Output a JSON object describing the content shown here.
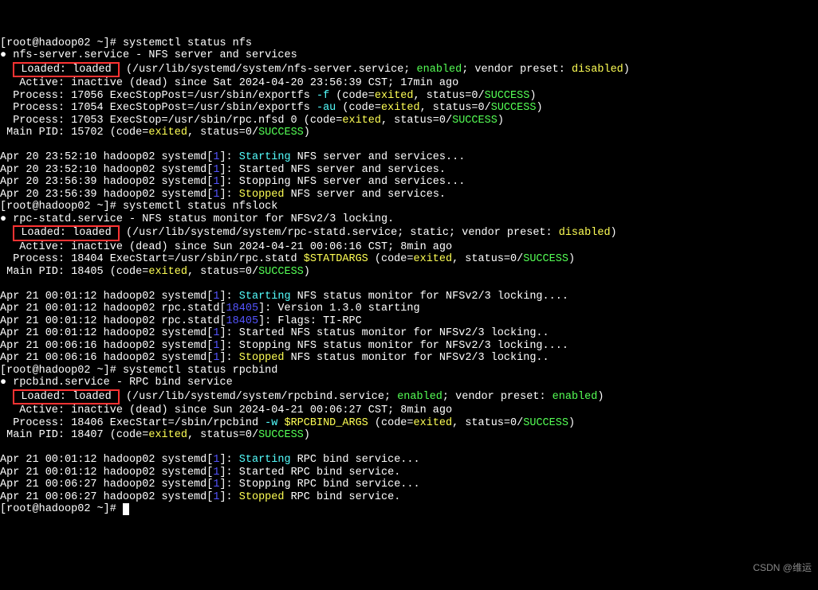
{
  "prompt1": "[root@hadoop02 ~]# ",
  "cmd1": "systemctl status nfs",
  "nfs": {
    "bullet": "●",
    "name": "nfs-server.service",
    "desc": "NFS server and services",
    "loaded_lbl": "Loaded: loaded",
    "loaded_rest": " (/usr/lib/systemd/system/nfs-server.service; ",
    "enabled": "enabled",
    "vendor_preset": "; vendor preset: ",
    "preset_state": "disabled",
    "close": ")",
    "active": "   Active: inactive (dead) since Sat 2024-04-20 23:56:39 CST; 17min ago",
    "proc1_a": "  Process: 17056 ExecStopPost=/usr/sbin/exportfs ",
    "proc1_flag": "-f",
    "proc1_b": " (code=",
    "exited": "exited",
    "status0": ", status=0/",
    "success": "SUCCESS",
    "proc2_a": "  Process: 17054 ExecStopPost=/usr/sbin/exportfs ",
    "proc2_flag": "-au",
    "proc2_b": " (code=",
    "proc3_a": "  Process: 17053 ExecStop=/usr/sbin/rpc.nfsd 0 (code=",
    "mainpid_a": " Main PID: 15702 (code=",
    "log1_a": "Apr 20 23:52:10 hadoop02 systemd[",
    "one": "1",
    "log1_b": "]: ",
    "starting": "Starting",
    "log1_c": " NFS server and services...",
    "log2_a": "Apr 20 23:52:10 hadoop02 systemd[",
    "log2_b": "]: Started NFS server and services.",
    "log3_a": "Apr 20 23:56:39 hadoop02 systemd[",
    "log3_b": "]: Stopping NFS server and services...",
    "log4_a": "Apr 20 23:56:39 hadoop02 systemd[",
    "log4_b": "]: ",
    "stopped": "Stopped",
    "log4_c": " NFS server and services."
  },
  "cmd2": "systemctl status nfslock",
  "statd": {
    "name": "rpc-statd.service",
    "desc": "NFS status monitor for NFSv2/3 locking.",
    "loaded_lbl": "Loaded: loaded",
    "loaded_rest": " (/usr/lib/systemd/system/rpc-statd.service; static; vendor preset: ",
    "preset_state": "disabled",
    "active": "   Active: inactive (dead) since Sun 2024-04-21 00:06:16 CST; 8min ago",
    "proc_a": "  Process: 18404 ExecStart=/usr/sbin/rpc.statd ",
    "statdargs": "$STATDARGS",
    "proc_b": " (code=",
    "mainpid_a": " Main PID: 18405 (code=",
    "log1_a": "Apr 21 00:01:12 hadoop02 systemd[",
    "log1_b": "]: ",
    "log1_c": " NFS status monitor for NFSv2/3 locking....",
    "log2_a": "Apr 21 00:01:12 hadoop02 rpc.statd[",
    "pid18405": "18405",
    "log2_b": "]: Version 1.3.0 starting",
    "log3_a": "Apr 21 00:01:12 hadoop02 rpc.statd[",
    "log3_b": "]: Flags: TI-RPC",
    "log4_a": "Apr 21 00:01:12 hadoop02 systemd[",
    "log4_b": "]: Started NFS status monitor for NFSv2/3 locking..",
    "log5_a": "Apr 21 00:06:16 hadoop02 systemd[",
    "log5_b": "]: Stopping NFS status monitor for NFSv2/3 locking....",
    "log6_a": "Apr 21 00:06:16 hadoop02 systemd[",
    "log6_b": "]: ",
    "log6_c": " NFS status monitor for NFSv2/3 locking.."
  },
  "cmd3": "systemctl status rpcbind",
  "rpc": {
    "name": "rpcbind.service",
    "desc": "RPC bind service",
    "loaded_lbl": "Loaded: loaded",
    "loaded_rest": " (/usr/lib/systemd/system/rpcbind.service; ",
    "enabled": "enabled",
    "vendor_preset": "; vendor preset: ",
    "preset_state": "enabled",
    "active": "   Active: inactive (dead) since Sun 2024-04-21 00:06:27 CST; 8min ago",
    "proc_a": "  Process: 18406 ExecStart=/sbin/rpcbind ",
    "flag": "-w",
    "rpcargs": "$RPCBIND_ARGS",
    "proc_b": " (code=",
    "mainpid_a": " Main PID: 18407 (code=",
    "log1_a": "Apr 21 00:01:12 hadoop02 systemd[",
    "log1_b": "]: ",
    "log1_c": " RPC bind service...",
    "log2_a": "Apr 21 00:01:12 hadoop02 systemd[",
    "log2_b": "]: Started RPC bind service.",
    "log3_a": "Apr 21 00:06:27 hadoop02 systemd[",
    "log3_b": "]: Stopping RPC bind service...",
    "log4_a": "Apr 21 00:06:27 hadoop02 systemd[",
    "log4_b": "]: ",
    "log4_c": " RPC bind service."
  },
  "watermark": "CSDN @维运"
}
